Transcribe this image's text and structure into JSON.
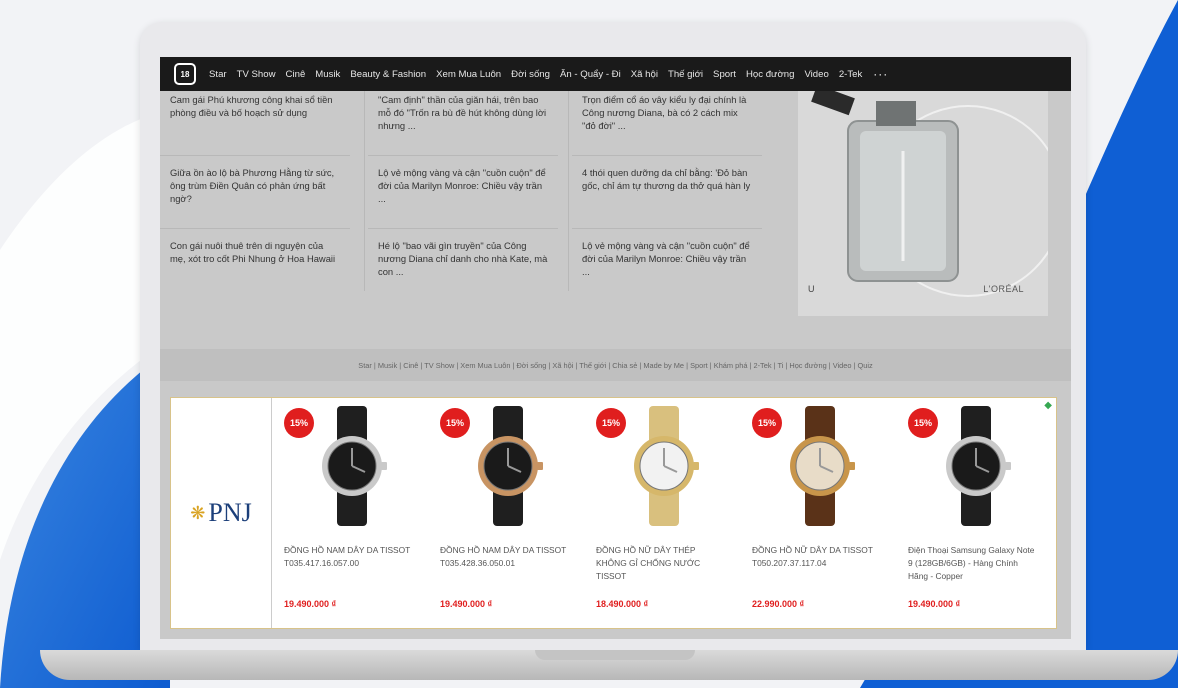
{
  "nav": {
    "logo": "18",
    "items": [
      "Star",
      "TV Show",
      "Cinê",
      "Musik",
      "Beauty & Fashion",
      "Xem Mua Luôn",
      "Đời sống",
      "Ăn - Quẩy - Đi",
      "Xã hội",
      "Thế giới",
      "Sport",
      "Học đường",
      "Video",
      "2-Tek"
    ],
    "more": "···"
  },
  "articles": [
    [
      "Cam gái Phú khương công khai sổ tiền phòng điều và bố hoạch sử dụng",
      "Giữa ồn ào lộ bà Phương Hằng từ sức, ông trùm Điền Quân có phản ứng bất ngờ?",
      "Con gái nuôi thuê trên di nguyện của mẹ, xót tro cốt Phi Nhung ở Hoa Hawaii"
    ],
    [
      "\"Cam định\" thần của giăn hái, trên bao mỗ đó \"Trốn ra bù đề hút không dùng lời nhưng ...",
      "Lộ vẻ mộng vàng và cận \"cuồn cuộn\" để đời của Marilyn Monroe: Chiều vậy trần ...",
      "Hé lộ \"bao vãi gìn truyền\" của Công nương Diana chỉ danh cho nhà Kate, mà con ..."
    ],
    [
      "Trọn điểm cổ áo vây kiểu ly đại chính là Công nương Diana, bà có 2 cách mix \"đỏ đời\" ...",
      "4 thói quen dưỡng da chỉ bằng: 'Đỏ bàn gốc, chỉ ám tự thương da thở quá hàn ly",
      "Lộ vẻ mộng vàng và cận \"cuồn cuộn\" để đời của Marilyn Monroe: Chiều vậy trần ..."
    ]
  ],
  "ad": {
    "brand": "L'ORÉAL",
    "corner": "U"
  },
  "footer_links": "Star | Musik | Cinê | TV Show | Xem Mua Luôn | Đời sống | Xã hội | Thế giới | Chia sẻ | Made by Me | Sport | Khám phá | 2-Tek | Ti | Học đường | Video | Quiz",
  "strip": {
    "brand_text": "PNJ",
    "brand_mark": "❋",
    "adchoice": "◆",
    "products": [
      {
        "badge": "15%",
        "name": "ĐỒNG HỒ NAM DÂY DA TISSOT T035.417.16.057.00",
        "price": "19.490.000 ₫",
        "dial": "#1a1a1a",
        "case": "#c9c9c9",
        "strap": "#1f1f1f"
      },
      {
        "badge": "15%",
        "name": "ĐỒNG HỒ NAM DÂY DA TISSOT T035.428.36.050.01",
        "price": "19.490.000 ₫",
        "dial": "#1a1a1a",
        "case": "#c89463",
        "strap": "#1f1f1f"
      },
      {
        "badge": "15%",
        "name": "ĐỒNG HỒ NỮ DÂY THÉP KHÔNG GỈ CHỐNG NƯỚC TISSOT",
        "price": "18.490.000 ₫",
        "dial": "#f2f2f2",
        "case": "#d6b76a",
        "strap": "#d9c07e"
      },
      {
        "badge": "15%",
        "name": "ĐỒNG HỒ NỮ DÂY DA TISSOT T050.207.37.117.04",
        "price": "22.990.000 ₫",
        "dial": "#e8dcc8",
        "case": "#c8954a",
        "strap": "#5a3218"
      },
      {
        "badge": "15%",
        "name": "Điện Thoại Samsung Galaxy Note 9 (128GB/6GB) - Hàng Chính Hãng - Copper",
        "price": "19.490.000 ₫",
        "dial": "#1a1a1a",
        "case": "#c9c9c9",
        "strap": "#1f1f1f"
      }
    ]
  },
  "colors": {
    "blue_shape": "#1565d8",
    "badge": "#e01e1e",
    "nav": "#1a1a1a"
  }
}
